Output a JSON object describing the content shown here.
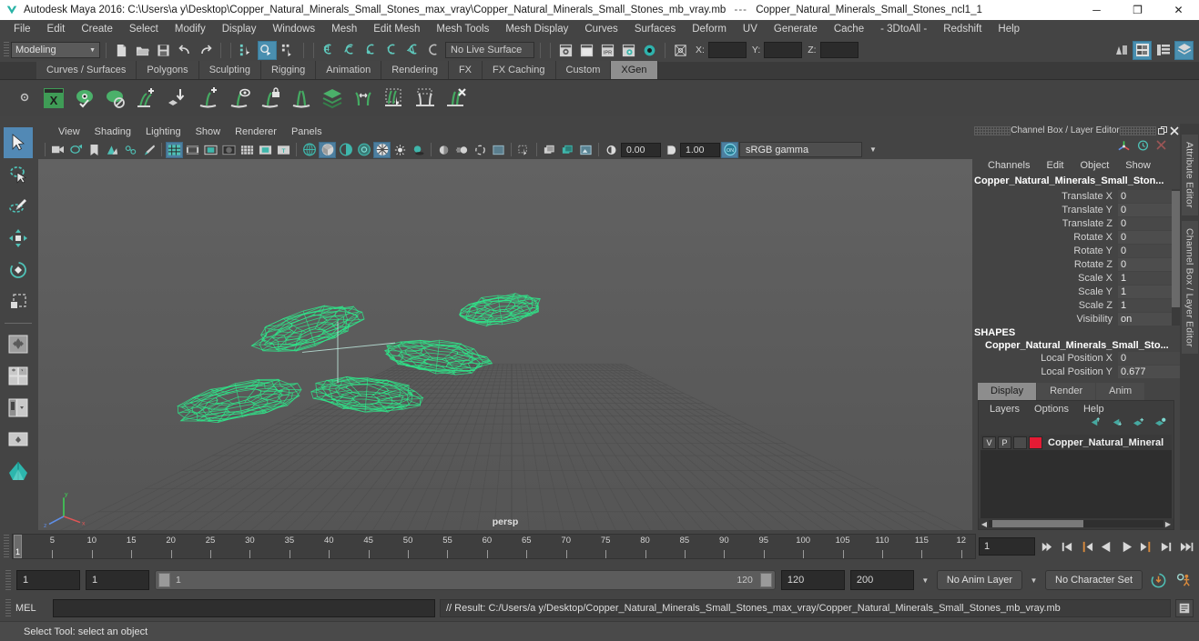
{
  "window": {
    "app_title": "Autodesk Maya 2016: C:\\Users\\a y\\Desktop\\Copper_Natural_Minerals_Small_Stones_max_vray\\Copper_Natural_Minerals_Small_Stones_mb_vray.mb",
    "title_separator": "---",
    "title_suffix": "Copper_Natural_Minerals_Small_Stones_ncl1_1",
    "minimize": "─",
    "maximize": "❐",
    "close": "✕"
  },
  "menubar": {
    "items": [
      "File",
      "Edit",
      "Create",
      "Select",
      "Modify",
      "Display",
      "Windows",
      "Mesh",
      "Edit Mesh",
      "Mesh Tools",
      "Mesh Display",
      "Curves",
      "Surfaces",
      "Deform",
      "UV",
      "Generate",
      "Cache",
      "- 3DtoAll -",
      "Redshift",
      "Help"
    ]
  },
  "statusline": {
    "menu_set": "Modeling",
    "live_surface": "No Live Surface",
    "x_label": "X:",
    "y_label": "Y:",
    "z_label": "Z:",
    "x_value": "",
    "y_value": "",
    "z_value": "",
    "icons": [
      "new-scene-icon",
      "open-scene-icon",
      "save-scene-icon",
      "undo-icon",
      "redo-icon",
      "select-hierarchy-icon",
      "select-object-icon",
      "select-component-icon",
      "snap-to-grid-icon",
      "snap-to-curve-icon",
      "snap-to-point-icon",
      "snap-to-projected-center-icon",
      "snap-to-view-plane-icon",
      "make-live-icon",
      "render-view-icon",
      "render-current-frame-icon",
      "ipr-render-icon",
      "render-settings-icon",
      "hypershade-icon",
      "selection-mask-icon",
      "show-hide-attribute-editor-icon",
      "show-hide-tool-settings-icon",
      "show-hide-channel-box-icon"
    ]
  },
  "shelf": {
    "tabs": [
      "Curves / Surfaces",
      "Polygons",
      "Sculpting",
      "Rigging",
      "Animation",
      "Rendering",
      "FX",
      "FX Caching",
      "Custom",
      "XGen"
    ],
    "active_tab": "XGen",
    "icons": [
      "xgen-window-icon",
      "xgen-preview-icon",
      "xgen-preview-off-icon",
      "xgen-add-description-icon",
      "xgen-import-collection-icon",
      "xgen-add-guide-icon",
      "xgen-preview-guide-icon",
      "xgen-lock-guide-icon",
      "xgen-sculpt-guide-icon",
      "xgen-layer-icon",
      "xgen-mirror-guide-icon",
      "xgen-select-guide-icon",
      "xgen-region-icon",
      "xgen-delete-guide-icon"
    ]
  },
  "toolbox": {
    "tools": [
      {
        "name": "select-tool",
        "selected": true
      },
      {
        "name": "lasso-select-tool",
        "selected": false
      },
      {
        "name": "paint-select-tool",
        "selected": false
      },
      {
        "name": "move-tool",
        "selected": false
      },
      {
        "name": "rotate-tool",
        "selected": false
      },
      {
        "name": "scale-tool",
        "selected": false
      },
      {
        "name": "last-tool-used",
        "selected": false
      },
      {
        "name": "four-view-layout",
        "selected": false
      },
      {
        "name": "persp-outliner-layout",
        "selected": false
      },
      {
        "name": "single-perspective-layout",
        "selected": false
      },
      {
        "name": "maya-paint-effects-icon",
        "selected": false
      }
    ]
  },
  "viewport": {
    "menu": [
      "View",
      "Shading",
      "Lighting",
      "Show",
      "Renderer",
      "Panels"
    ],
    "camera_label": "persp",
    "exposure": "0.00",
    "gamma": "1.00",
    "color_profile": "sRGB gamma",
    "background_top": "#606060",
    "background_bottom": "#585858",
    "wireframe_color": "#2ee88a",
    "grid_color": "#4d4d4d",
    "toolbar_icons": [
      "camera-attributes-icon",
      "bookmark-icon",
      "image-plane-icon",
      "two-d-pan-zoom-icon",
      "grease-pencil-icon",
      "paint-effects-toggle-icon",
      "grid-toggle-icon",
      "film-gate-icon",
      "resolution-gate-icon",
      "gate-mask-icon",
      "field-chart-icon",
      "safe-action-icon",
      "safe-title-icon",
      "wireframe-icon",
      "smooth-shade-all-icon",
      "shade-x-ray-icon",
      "x-ray-joints-icon",
      "texture-toggle-icon",
      "use-all-lights-icon",
      "shadows-icon",
      "screen-space-ao-icon",
      "motion-blur-icon",
      "multisample-icon",
      "isolate-select-icon",
      "xray-toggle-icon",
      "display-layer-icon",
      "panel-snapshot-icon",
      "exposure-icon",
      "gamma-icon",
      "view-transform-icon"
    ]
  },
  "channelbox": {
    "panel_title": "Channel Box / Layer Editor",
    "menu": [
      "Channels",
      "Edit",
      "Object",
      "Show"
    ],
    "object_name": "Copper_Natural_Minerals_Small_Ston...",
    "transform_rows": [
      {
        "label": "Translate X",
        "value": "0"
      },
      {
        "label": "Translate Y",
        "value": "0"
      },
      {
        "label": "Translate Z",
        "value": "0"
      },
      {
        "label": "Rotate X",
        "value": "0"
      },
      {
        "label": "Rotate Y",
        "value": "0"
      },
      {
        "label": "Rotate Z",
        "value": "0"
      },
      {
        "label": "Scale X",
        "value": "1"
      },
      {
        "label": "Scale Y",
        "value": "1"
      },
      {
        "label": "Scale Z",
        "value": "1"
      },
      {
        "label": "Visibility",
        "value": "on"
      }
    ],
    "shapes_header": "SHAPES",
    "shape_name": "Copper_Natural_Minerals_Small_Sto...",
    "shape_rows": [
      {
        "label": "Local Position X",
        "value": "0"
      },
      {
        "label": "Local Position Y",
        "value": "0.677"
      }
    ],
    "side_tabs": [
      "Attribute Editor",
      "Channel Box / Layer Editor"
    ],
    "header_icons": [
      "channel-box-icon",
      "clock-icon",
      "close-icon"
    ]
  },
  "layereditor": {
    "tabs": [
      "Display",
      "Render",
      "Anim"
    ],
    "active_tab": "Display",
    "menu": [
      "Layers",
      "Options",
      "Help"
    ],
    "toolbar_icons": [
      "move-layer-up-icon",
      "move-layer-down-icon",
      "new-layer-icon",
      "new-layer-from-selected-icon"
    ],
    "layers": [
      {
        "visibility": "V",
        "playback": "P",
        "mode": "",
        "color": "#e41b34",
        "name": "Copper_Natural_Mineral"
      }
    ]
  },
  "timeslider": {
    "current_frame": "1",
    "current_frame_field": "1",
    "tick_labels": [
      "5",
      "10",
      "15",
      "20",
      "25",
      "30",
      "35",
      "40",
      "45",
      "50",
      "55",
      "60",
      "65",
      "70",
      "75",
      "80",
      "85",
      "90",
      "95",
      "100",
      "105",
      "110",
      "115",
      "12"
    ],
    "playback_buttons": [
      "go-to-start-icon",
      "step-back-frame-icon",
      "step-back-key-icon",
      "play-backwards-icon",
      "play-forwards-icon",
      "step-forward-key-icon",
      "step-forward-frame-icon",
      "go-to-end-icon"
    ]
  },
  "rangeslider": {
    "anim_start": "1",
    "playback_start": "1",
    "range_start_label": "1",
    "range_end_label": "120",
    "playback_end": "120",
    "anim_end": "200",
    "anim_layer": "No Anim Layer",
    "character_set": "No Character Set",
    "icons": [
      "auto-keyframe-icon",
      "animation-preferences-icon"
    ]
  },
  "commandline": {
    "label": "MEL",
    "input_value": "",
    "input_placeholder": "",
    "result_text": "// Result: C:/Users/a y/Desktop/Copper_Natural_Minerals_Small_Stones_max_vray/Copper_Natural_Minerals_Small_Stones_mb_vray.mb",
    "script_editor_icon": "script-editor-icon"
  },
  "helpline": {
    "text": "Select Tool: select an object"
  }
}
